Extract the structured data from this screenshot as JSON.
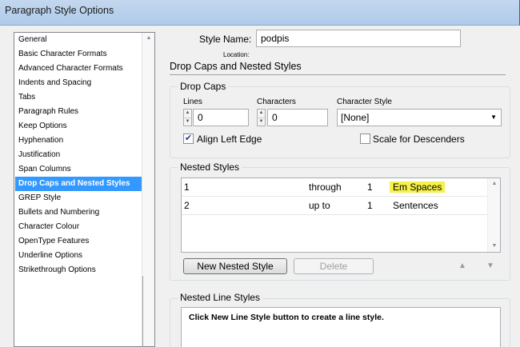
{
  "window": {
    "title": "Paragraph Style Options"
  },
  "sidebar": {
    "items": [
      {
        "label": "General"
      },
      {
        "label": "Basic Character Formats"
      },
      {
        "label": "Advanced Character Formats"
      },
      {
        "label": "Indents and Spacing"
      },
      {
        "label": "Tabs"
      },
      {
        "label": "Paragraph Rules"
      },
      {
        "label": "Keep Options"
      },
      {
        "label": "Hyphenation"
      },
      {
        "label": "Justification"
      },
      {
        "label": "Span Columns"
      },
      {
        "label": "Drop Caps and Nested Styles",
        "selected": true
      },
      {
        "label": "GREP Style"
      },
      {
        "label": "Bullets and Numbering"
      },
      {
        "label": "Character Colour"
      },
      {
        "label": "OpenType Features"
      },
      {
        "label": "Underline Options"
      },
      {
        "label": "Strikethrough Options"
      }
    ]
  },
  "header": {
    "style_name_label": "Style Name:",
    "style_name_value": "podpis",
    "location_label": "Location:",
    "section_title": "Drop Caps and Nested Styles"
  },
  "drop_caps": {
    "title": "Drop Caps",
    "lines_label": "Lines",
    "lines_value": "0",
    "characters_label": "Characters",
    "characters_value": "0",
    "character_style_label": "Character Style",
    "character_style_value": "[None]",
    "align_left_edge_label": "Align Left Edge",
    "align_left_edge_checked": true,
    "scale_descenders_label": "Scale for Descenders",
    "scale_descenders_checked": false
  },
  "nested_styles": {
    "title": "Nested Styles",
    "rows": [
      {
        "style": "1",
        "mode": "through",
        "count": "1",
        "unit": "Em Spaces",
        "highlight_color": "#f5f04a"
      },
      {
        "style": "2",
        "mode": "up to",
        "count": "1",
        "unit": "Sentences"
      }
    ],
    "new_button_label": "New Nested Style",
    "delete_button_label": "Delete"
  },
  "nested_line_styles": {
    "title": "Nested Line Styles",
    "hint": "Click New Line Style button to create a line style."
  },
  "icons": {
    "scroll_up": "▲",
    "scroll_down": "▼",
    "caret": "▼",
    "check": "✔"
  }
}
